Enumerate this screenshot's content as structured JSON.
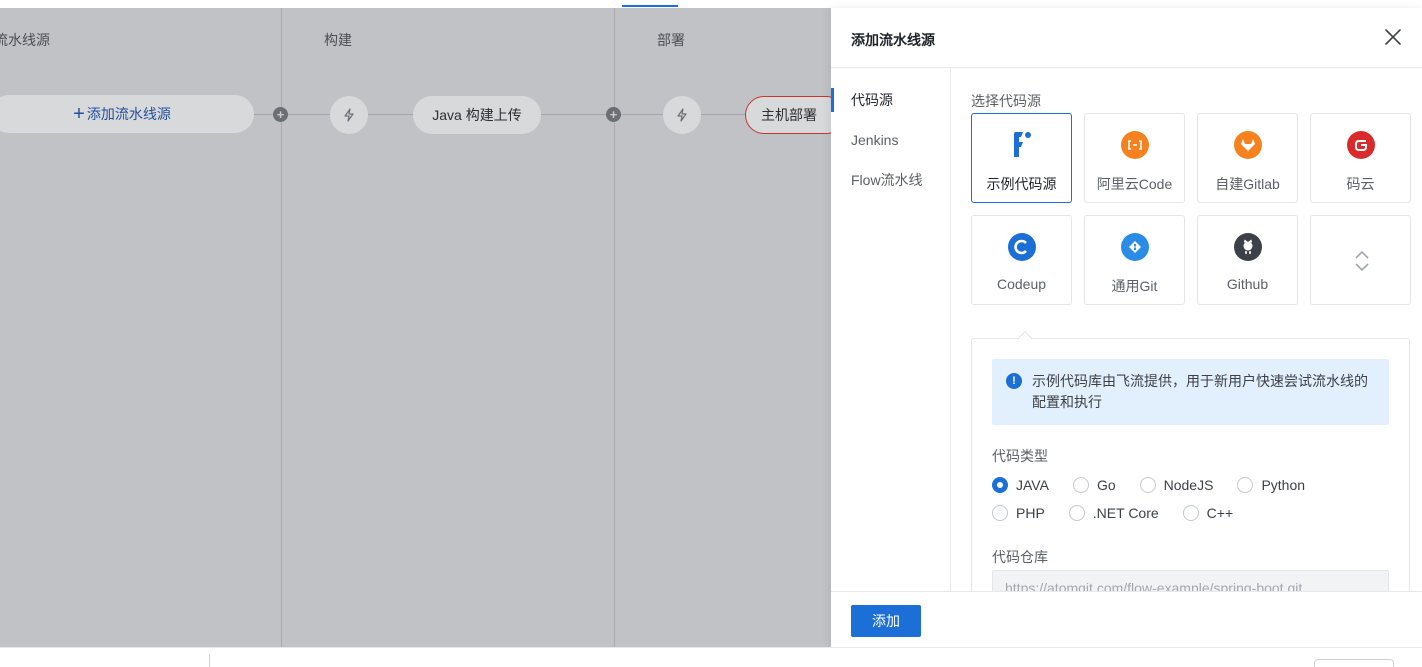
{
  "pipeline": {
    "stages": [
      "流水线源",
      "构建",
      "部署"
    ],
    "add_source_label": "添加流水线源",
    "build_job": "Java 构建上传",
    "deploy_job": "主机部署"
  },
  "drawer": {
    "title": "添加流水线源",
    "nav": [
      "代码源",
      "Jenkins",
      "Flow流水线"
    ],
    "select_source_label": "选择代码源",
    "sources": [
      {
        "label": "示例代码源",
        "icon": "flow-icon",
        "color": "#1b6fd6"
      },
      {
        "label": "阿里云Code",
        "icon": "aliyun-code-icon",
        "color": "#f5811f"
      },
      {
        "label": "自建Gitlab",
        "icon": "gitlab-icon",
        "color": "#f5811f"
      },
      {
        "label": "码云",
        "icon": "gitee-icon",
        "color": "#d92b2b"
      },
      {
        "label": "Codeup",
        "icon": "codeup-icon",
        "color": "#1b6fd6"
      },
      {
        "label": "通用Git",
        "icon": "git-icon",
        "color": "#2b8ce6"
      },
      {
        "label": "Github",
        "icon": "github-icon",
        "color": "#3d4047"
      }
    ],
    "info_text": "示例代码库由飞流提供，用于新用户快速尝试流水线的配置和执行",
    "code_type_label": "代码类型",
    "code_types": [
      "JAVA",
      "Go",
      "NodeJS",
      "Python",
      "PHP",
      ".NET Core",
      "C++"
    ],
    "selected_code_type": "JAVA",
    "repo_label": "代码仓库",
    "repo_value": "https://atomgit.com/flow-example/spring-boot.git",
    "add_button": "添加"
  },
  "colors": {
    "accent": "#1b6fd6",
    "overlay": "#c1c2c5",
    "error_border": "#c8352c"
  }
}
